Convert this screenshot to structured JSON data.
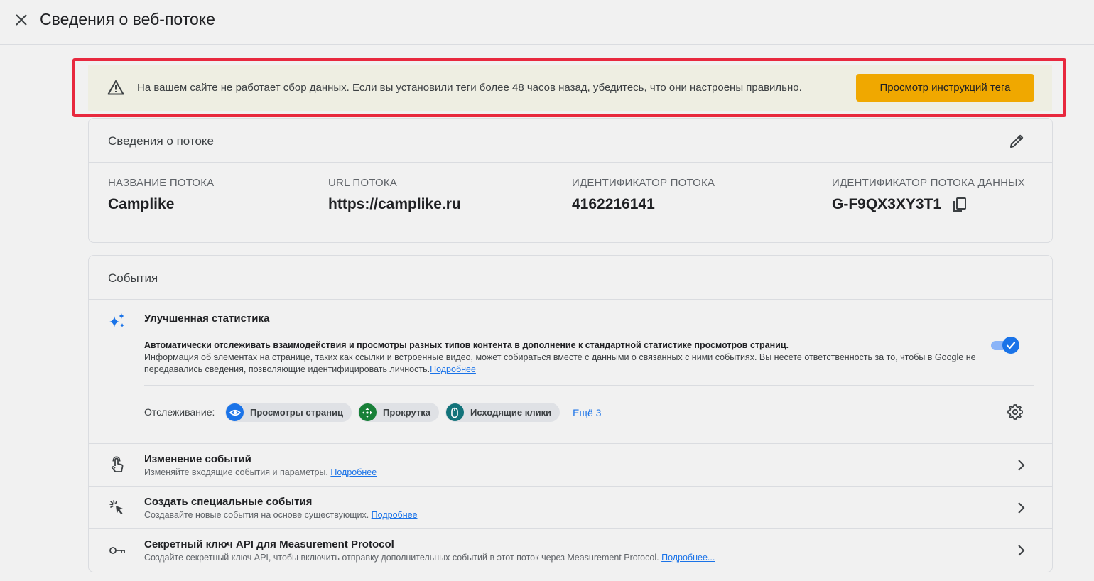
{
  "header": {
    "title": "Сведения о веб-потоке",
    "close_icon": "close-icon"
  },
  "alert": {
    "icon": "warning-icon",
    "message": "На вашем сайте не работает сбор данных. Если вы установили теги более 48 часов назад, убедитесь, что они настроены правильно.",
    "button_label": "Просмотр инструкций тега",
    "button_color": "#f0a800",
    "outline_color": "#e8283e"
  },
  "stream_details": {
    "title": "Сведения о потоке",
    "fields": [
      {
        "label": "НАЗВАНИЕ ПОТОКА",
        "value": "Camplike"
      },
      {
        "label": "URL ПОТОКА",
        "value": "https://camplike.ru"
      },
      {
        "label": "ИДЕНТИФИКАТОР ПОТОКА",
        "value": "4162216141"
      },
      {
        "label": "ИДЕНТИФИКАТОР ПОТОКА ДАННЫХ",
        "value": "G-F9QX3XY3T1"
      }
    ]
  },
  "events": {
    "title": "События",
    "enhanced": {
      "title": "Улучшенная статистика",
      "desc_line1": "Автоматически отслеживать взаимодействия и просмотры разных типов контента в дополнение к стандартной статистике просмотров страниц.",
      "desc_line2": "Информация об элементах на странице, таких как ссылки и встроенные видео, может собираться вместе с данными о связанных с ними событиях. Вы несете ответственность за то, чтобы в Google не передавались сведения, позволяющие идентифицировать личность.",
      "learn_more": "Подробнее",
      "toggle_on": true,
      "tracking_label": "Отслеживание:",
      "chips": [
        {
          "label": "Просмотры страниц",
          "icon": "eye-icon",
          "color": "#1a73e8"
        },
        {
          "label": "Прокрутка",
          "icon": "scroll-icon",
          "color": "#188038"
        },
        {
          "label": "Исходящие клики",
          "icon": "mouse-icon",
          "color": "#12737a"
        }
      ],
      "more": "Ещё 3"
    },
    "rows": [
      {
        "title": "Изменение событий",
        "subtitle": "Изменяйте входящие события и параметры.",
        "link": "Подробнее",
        "icon": "touch-icon"
      },
      {
        "title": "Создать специальные события",
        "subtitle": "Создавайте новые события на основе существующих.",
        "link": "Подробнее",
        "icon": "cursor-click-icon"
      },
      {
        "title": "Секретный ключ API для Measurement Protocol",
        "subtitle": "Создайте секретный ключ API, чтобы включить отправку дополнительных событий в этот поток через Measurement Protocol.",
        "link": "Подробнее...",
        "icon": "key-icon"
      }
    ]
  }
}
